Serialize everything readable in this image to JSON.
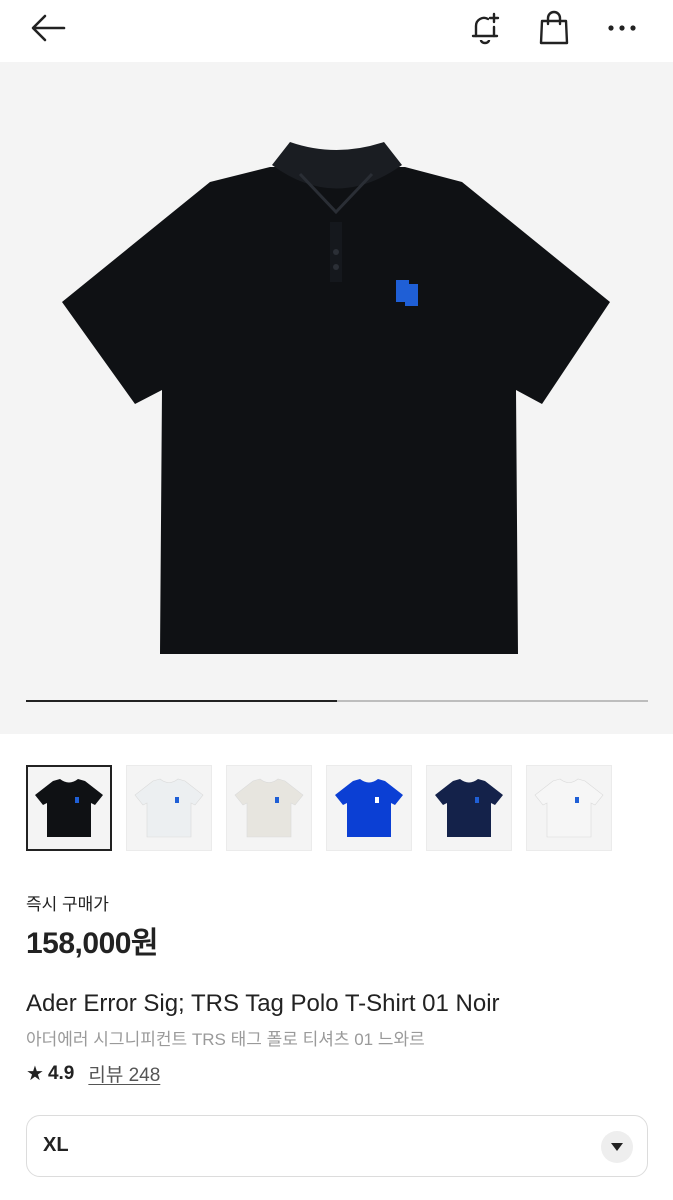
{
  "header": {
    "back_icon": "arrow-left-icon",
    "notify_icon": "bell-plus-icon",
    "bag_icon": "shopping-bag-icon",
    "more_icon": "more-horizontal-icon"
  },
  "gallery": {
    "progress": 0.5,
    "main_color": "#0f1114",
    "logo_color": "#1f5fd6",
    "thumbnails": [
      {
        "color": "black",
        "hex": "#0f1114",
        "selected": true
      },
      {
        "color": "light-gray",
        "hex": "#eceff1",
        "selected": false
      },
      {
        "color": "cream",
        "hex": "#e7e5df",
        "selected": false
      },
      {
        "color": "blue",
        "hex": "#0b3fd4",
        "selected": false
      },
      {
        "color": "navy",
        "hex": "#14224a",
        "selected": false
      },
      {
        "color": "white",
        "hex": "#f6f6f6",
        "selected": false
      }
    ]
  },
  "product": {
    "price_label": "즉시 구매가",
    "price": "158,000원",
    "name_en": "Ader Error Sig; TRS Tag Polo T-Shirt 01 Noir",
    "name_ko": "아더에러 시그니피컨트 TRS 태그 폴로 티셔츠 01 느와르",
    "rating": "4.9",
    "reviews": "리뷰 248"
  },
  "size_select": {
    "value": "XL"
  }
}
